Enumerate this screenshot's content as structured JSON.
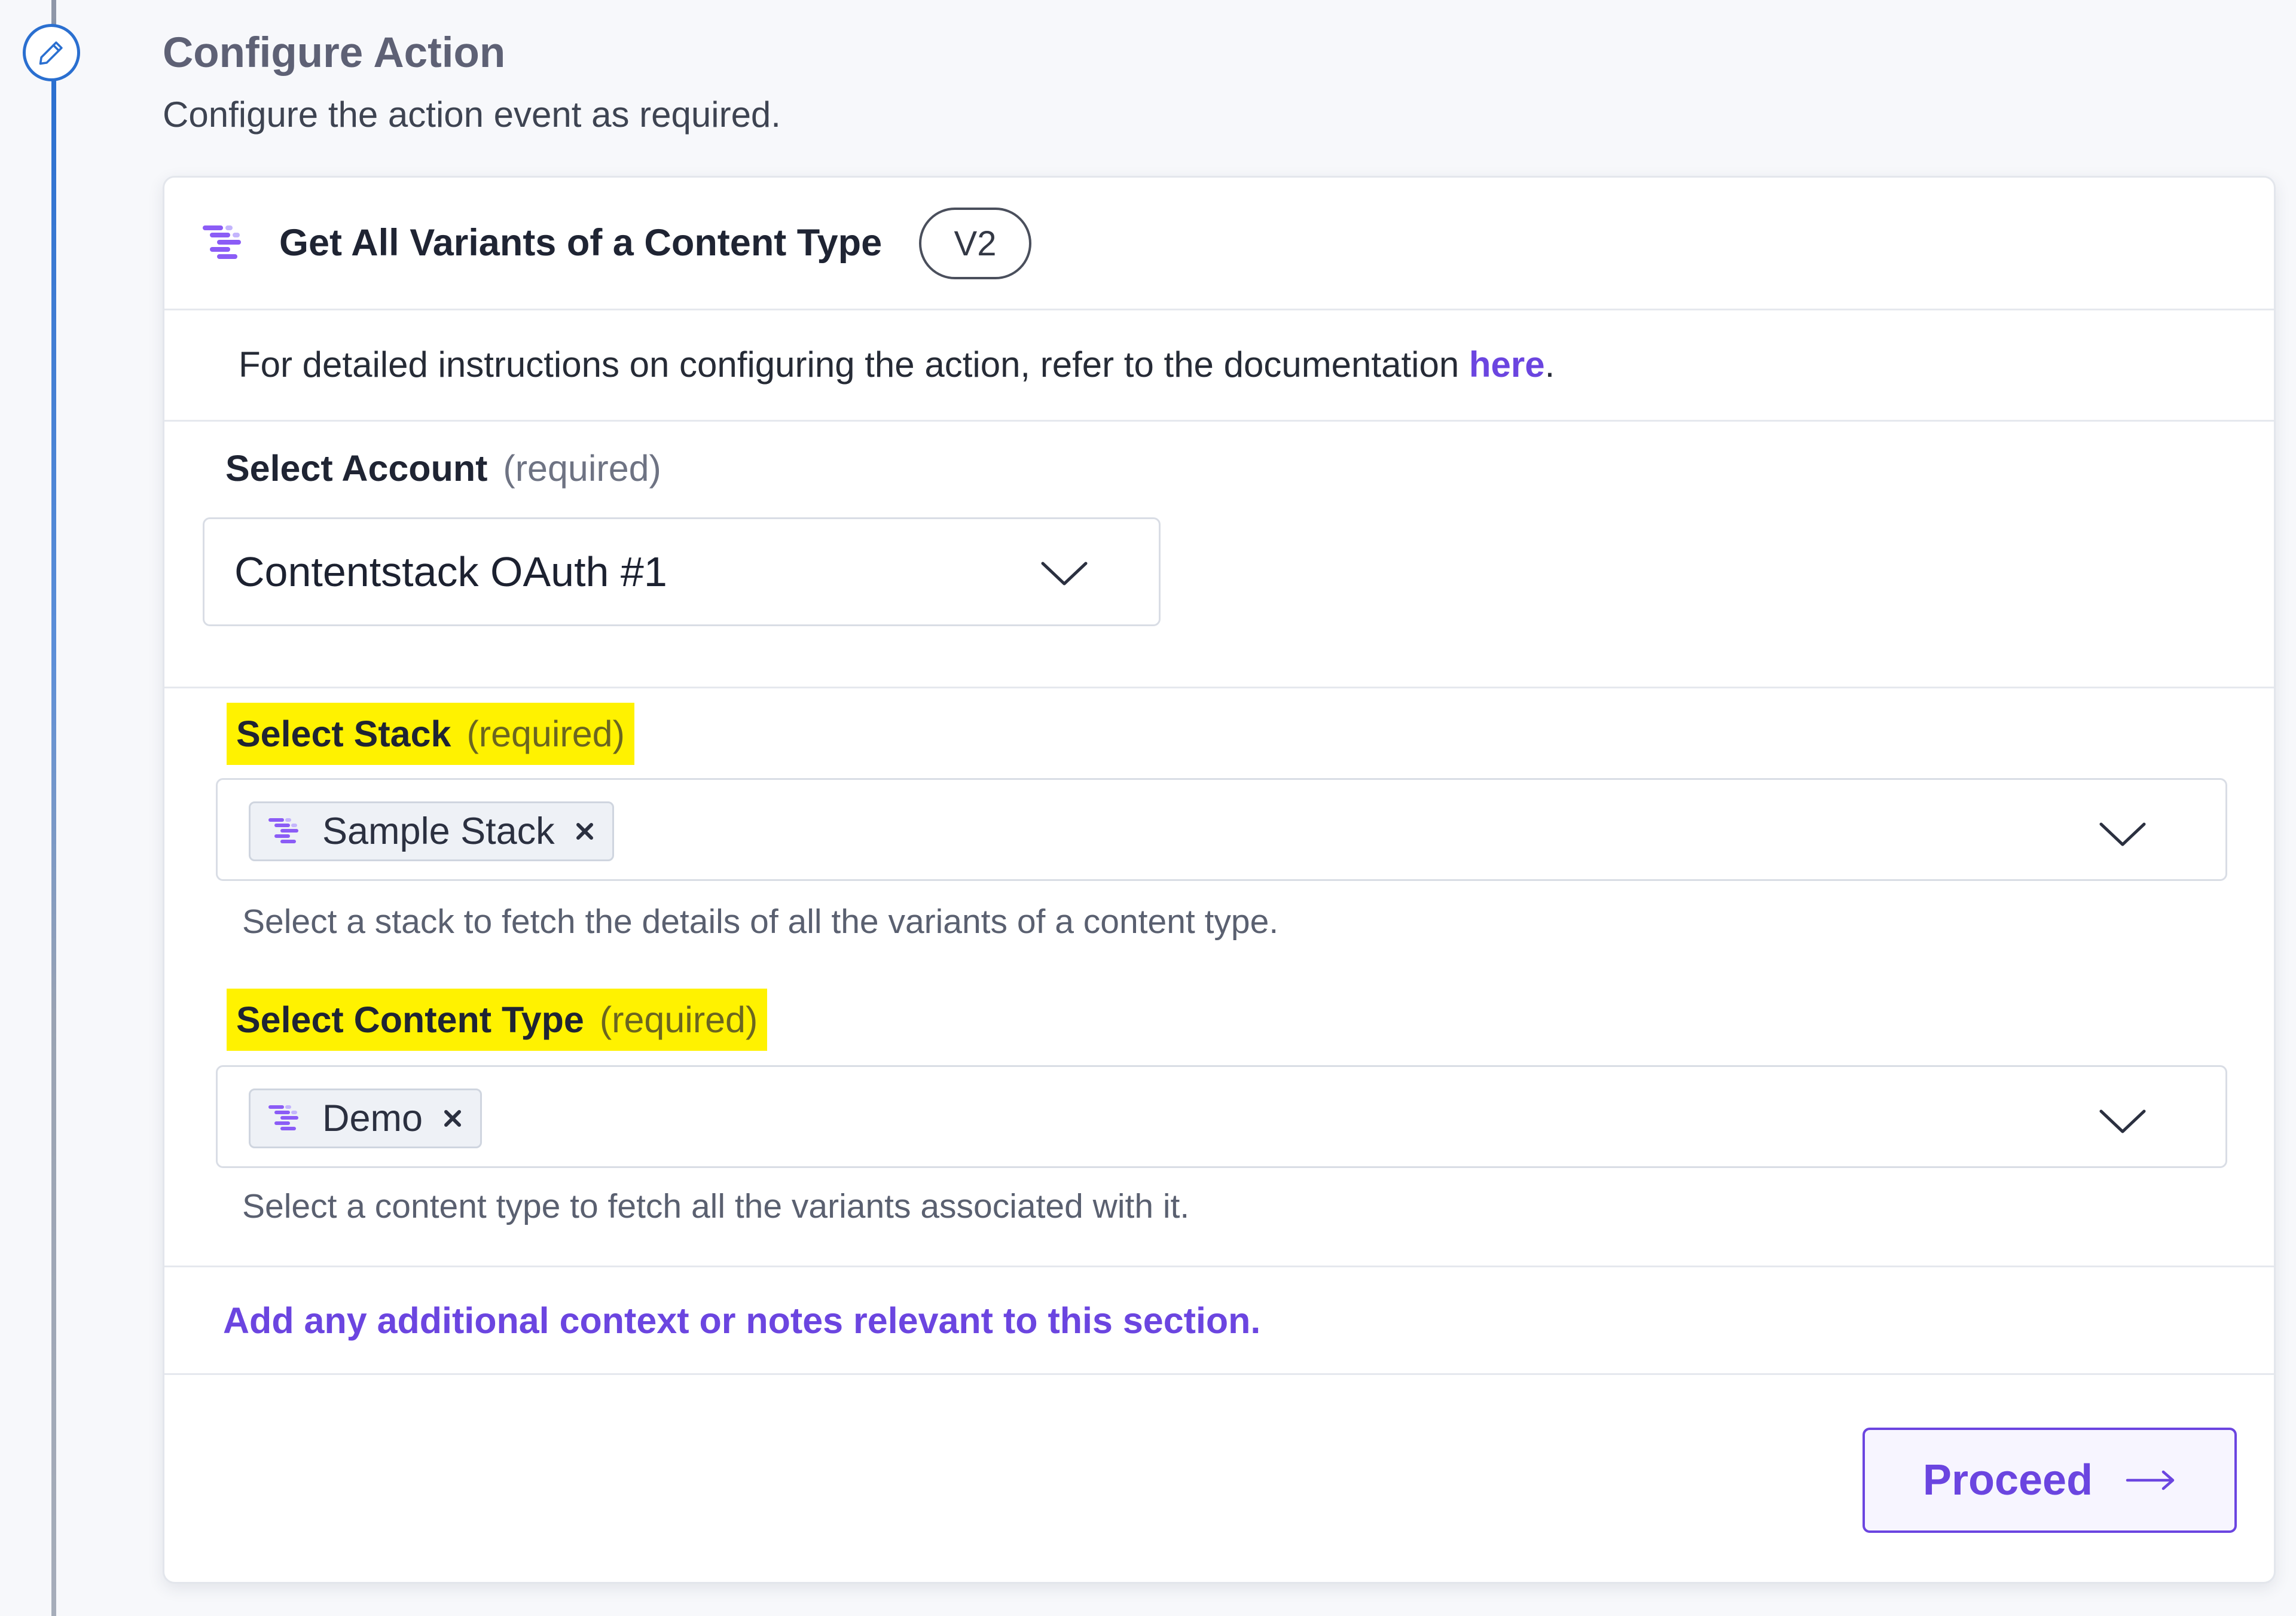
{
  "section": {
    "title": "Configure Action",
    "subtitle": "Configure the action event as required."
  },
  "action": {
    "icon": "contentstack-logo-icon",
    "title": "Get All Variants of a Content Type",
    "version": "V2"
  },
  "documentation": {
    "text": "For detailed instructions on configuring the action, refer to the documentation ",
    "link_label": "here",
    "suffix": "."
  },
  "fields": {
    "account": {
      "label": "Select Account",
      "required": "(required)",
      "value": "Contentstack OAuth #1"
    },
    "stack": {
      "label": "Select Stack",
      "required": "(required)",
      "chip": "Sample Stack",
      "help": "Select a stack to fetch the details of all the variants of a content type."
    },
    "content_type": {
      "label": "Select Content Type",
      "required": "(required)",
      "chip": "Demo",
      "help": "Select a content type to fetch all the variants associated with it."
    }
  },
  "notes": {
    "label": "Add any additional context or notes relevant to this section."
  },
  "footer": {
    "proceed_label": "Proceed"
  },
  "colors": {
    "accent": "#6b45e0",
    "timeline": "#2a6fd0",
    "highlight": "#fff200"
  }
}
